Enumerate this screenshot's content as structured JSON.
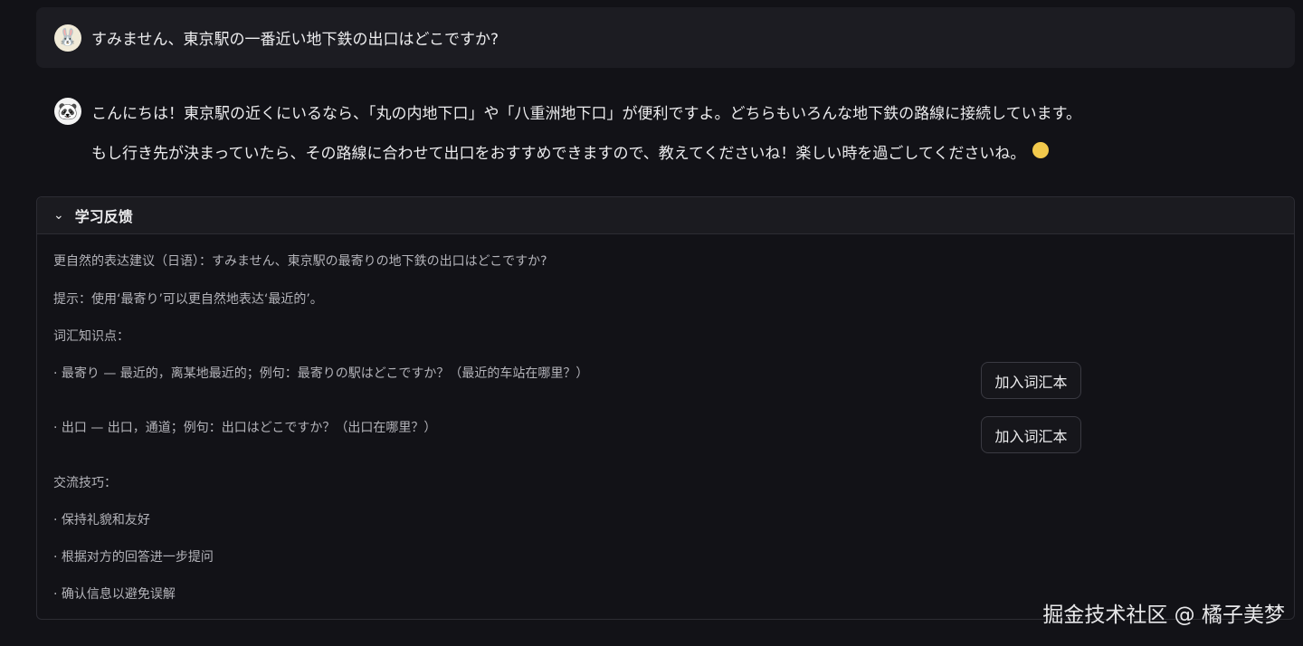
{
  "user_message": {
    "avatar": "bunny-avatar-icon",
    "text": "すみません、東京駅の一番近い地下鉄の出口はどこですか?"
  },
  "bot_message": {
    "avatar": "panda-avatar-icon",
    "line1": "こんにちは！東京駅の近くにいるなら、「丸の内地下口」や「八重洲地下口」が便利ですよ。どちらもいろんな地下鉄の路線に接続しています。",
    "line2": "もし行き先が決まっていたら、その路線に合わせて出口をおすすめできますので、教えてくださいね！楽しい時を過ごしてくださいね。",
    "emoji": "smiling-face-emoji"
  },
  "feedback": {
    "title": "学习反馈",
    "suggestion": "更自然的表达建议（日语）：すみません、東京駅の最寄りの地下鉄の出口はどこですか?",
    "hint": "提示：使用‘最寄り’可以更自然地表达‘最近的’。",
    "vocab_heading": "词汇知识点：",
    "vocab": [
      {
        "text": "· 最寄り — 最近的，离某地最近的；例句：最寄りの駅はどこですか？（最近的车站在哪里？）",
        "button": "加入词汇本"
      },
      {
        "text": "· 出口 — 出口，通道；例句：出口はどこですか？（出口在哪里？）",
        "button": "加入词汇本"
      }
    ],
    "tips_heading": "交流技巧：",
    "tips": [
      "· 保持礼貌和友好",
      "· 根据对方的回答进一步提问",
      "· 确认信息以避免误解"
    ]
  },
  "watermark": "掘金技术社区 @ 橘子美梦"
}
